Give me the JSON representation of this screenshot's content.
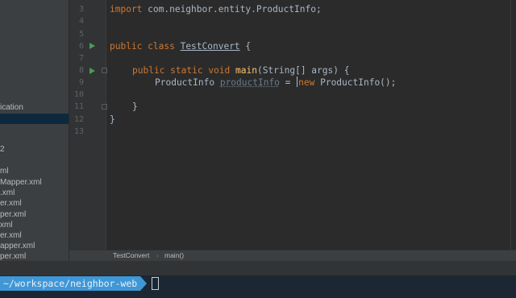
{
  "sidebar": {
    "items": [
      {
        "label": "ication",
        "selected": false
      },
      {
        "label": "",
        "selected": true
      },
      {
        "label": "2",
        "selected": false
      },
      {
        "label": "ml",
        "selected": false
      },
      {
        "label": "Mapper.xml",
        "selected": false
      },
      {
        "label": ".xml",
        "selected": false
      },
      {
        "label": "er.xml",
        "selected": false
      },
      {
        "label": "per.xml",
        "selected": false
      },
      {
        "label": "xml",
        "selected": false
      },
      {
        "label": "er.xml",
        "selected": false
      },
      {
        "label": "apper.xml",
        "selected": false
      },
      {
        "label": "per.xml",
        "selected": false
      }
    ]
  },
  "gutter": {
    "line_numbers": [
      "3",
      "4",
      "5",
      "6",
      "7",
      "8",
      "9",
      "10",
      "11",
      "12",
      "13"
    ]
  },
  "editor": {
    "lines": {
      "import_kw": "import",
      "import_path": " com.neighbor.entity.ProductInfo;",
      "class_public": "public",
      "class_kw": " class ",
      "class_name": "TestConvert",
      "class_brace": " {",
      "method_public": "public",
      "method_static": " static",
      "method_void": " void ",
      "method_name": "main",
      "method_params": "(String[] args) {",
      "stmt_type": "ProductInfo ",
      "stmt_var": "productInfo",
      "stmt_eq": " = ",
      "stmt_new": "new",
      "stmt_ctor": " ProductInfo();",
      "close_method": "}",
      "close_class": "}"
    }
  },
  "breadcrumb": {
    "class": "TestConvert",
    "separator": "›",
    "method": "main()"
  },
  "terminal": {
    "prompt_path": "~/workspace/neighbor-web"
  },
  "colors": {
    "editor_bg": "#2b2b2b",
    "keyword": "#cc7832",
    "function": "#ffc66d",
    "text": "#a9b7c6",
    "prompt_bg": "#3f97d6",
    "terminal_bg": "#1c2733"
  },
  "icons": [
    "run-gutter-icon",
    "fold-icon"
  ]
}
